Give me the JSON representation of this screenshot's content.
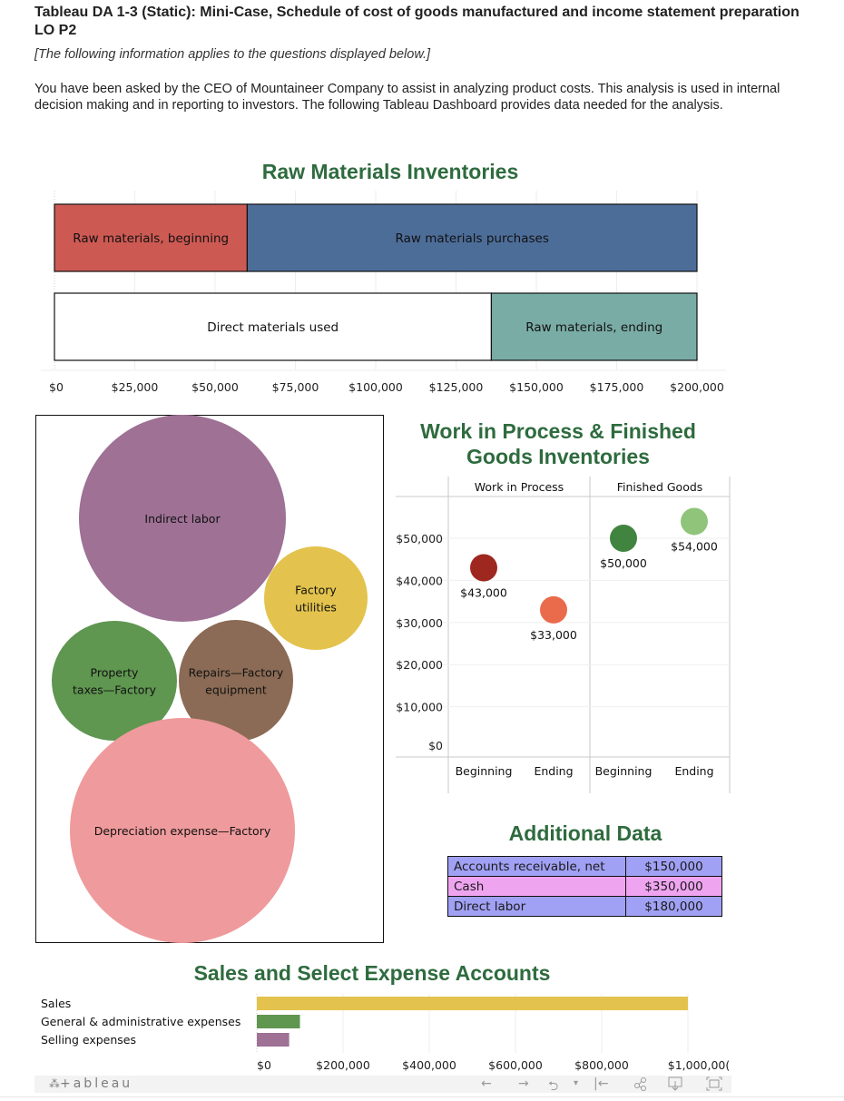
{
  "header": {
    "title": "Tableau DA 1-3 (Static): Mini-Case, Schedule of cost of goods manufactured and income statement preparation LO P2",
    "note": "[The following information applies to the questions displayed below.]",
    "intro": "You have been asked by the CEO of Mountaineer Company to assist in analyzing product costs. This analysis is used in internal decision making and in reporting to investors. The following Tableau Dashboard provides data needed for the analysis."
  },
  "colors": {
    "title_green": "#2e6b3e",
    "rm_beginning": "#cd5953",
    "rm_purchases": "#4d6d99",
    "dm_used": "#ffffff",
    "rm_ending": "#7aaca6",
    "indirect_labor": "#9e7195",
    "factory_utilities": "#e3c34d",
    "property_taxes": "#5f9650",
    "repairs": "#8b6b55",
    "depreciation": "#ef9a9c",
    "wip_beginning": "#9e2720",
    "wip_ending": "#ea6b4b",
    "fg_beginning": "#418440",
    "fg_ending": "#8fc47a",
    "sales": "#e3c34d",
    "ga": "#5f9650",
    "selling": "#9e7195",
    "row_blue": "#a0a0f4",
    "row_pink": "#efa4f0"
  },
  "chart_data": [
    {
      "id": "raw-materials",
      "type": "bar",
      "orientation": "horizontal-stacked",
      "title": "Raw Materials Inventories",
      "xlim": [
        0,
        200000
      ],
      "xticks": [
        "$0",
        "$25,000",
        "$50,000",
        "$75,000",
        "$100,000",
        "$125,000",
        "$150,000",
        "$175,000",
        "$200,000"
      ],
      "xtick_values": [
        0,
        25000,
        50000,
        75000,
        100000,
        125000,
        150000,
        175000,
        200000
      ],
      "grid": true,
      "rows": [
        {
          "segments": [
            {
              "name": "Raw materials, beginning",
              "value": 60000,
              "color_key": "rm_beginning"
            },
            {
              "name": "Raw materials purchases",
              "value": 140000,
              "color_key": "rm_purchases"
            }
          ]
        },
        {
          "segments": [
            {
              "name": "Direct materials used",
              "value": 136000,
              "color_key": "dm_used"
            },
            {
              "name": "Raw materials, ending",
              "value": 64000,
              "color_key": "rm_ending"
            }
          ]
        }
      ]
    },
    {
      "id": "factory-overhead",
      "type": "bubble",
      "title": "",
      "bubbles": [
        {
          "name": "Indirect labor",
          "label_lines": [
            "Indirect labor"
          ],
          "relative_size": 1.0,
          "color_key": "indirect_labor"
        },
        {
          "name": "Factory utilities",
          "label_lines": [
            "Factory",
            "utilities"
          ],
          "relative_size": 0.25,
          "color_key": "factory_utilities"
        },
        {
          "name": "Property taxes—Factory",
          "label_lines": [
            "Property",
            "taxes—Factory"
          ],
          "relative_size": 0.36,
          "color_key": "property_taxes"
        },
        {
          "name": "Repairs—Factory equipment",
          "label_lines": [
            "Repairs—Factory",
            "equipment"
          ],
          "relative_size": 0.32,
          "color_key": "repairs"
        },
        {
          "name": "Depreciation expense—Factory",
          "label_lines": [
            "Depreciation expense—Factory"
          ],
          "relative_size": 1.18,
          "color_key": "depreciation"
        }
      ]
    },
    {
      "id": "wip-fg",
      "type": "scatter",
      "title": "Work in Process & Finished Goods Inventories",
      "title_lines": [
        "Work in Process & Finished",
        "Goods Inventories"
      ],
      "ylim": [
        0,
        58000
      ],
      "yticks": [
        "$0",
        "$10,000",
        "$20,000",
        "$30,000",
        "$40,000",
        "$50,000"
      ],
      "ytick_values": [
        0,
        10000,
        20000,
        30000,
        40000,
        50000
      ],
      "grid": true,
      "panels": [
        {
          "name": "Work in Process",
          "points": [
            {
              "x": "Beginning",
              "value": 43000,
              "label": "$43,000",
              "color_key": "wip_beginning"
            },
            {
              "x": "Ending",
              "value": 33000,
              "label": "$33,000",
              "color_key": "wip_ending"
            }
          ]
        },
        {
          "name": "Finished Goods",
          "points": [
            {
              "x": "Beginning",
              "value": 50000,
              "label": "$50,000",
              "color_key": "fg_beginning"
            },
            {
              "x": "Ending",
              "value": 54000,
              "label": "$54,000",
              "color_key": "fg_ending"
            }
          ]
        }
      ]
    },
    {
      "id": "additional-data",
      "type": "table",
      "title": "Additional Data",
      "rows": [
        {
          "label": "Accounts receivable, net",
          "value": "$150,000",
          "color_key": "row_blue"
        },
        {
          "label": "Cash",
          "value": "$350,000",
          "color_key": "row_pink"
        },
        {
          "label": "Direct labor",
          "value": "$180,000",
          "color_key": "row_blue"
        }
      ]
    },
    {
      "id": "sales-expenses",
      "type": "bar",
      "orientation": "horizontal",
      "title": "Sales and Select Expense Accounts",
      "categories": [
        "Sales",
        "General & administrative expenses",
        "Selling expenses"
      ],
      "values": [
        1000000,
        100000,
        75000
      ],
      "color_keys": [
        "sales",
        "ga",
        "selling"
      ],
      "xlim": [
        0,
        1000000
      ],
      "xticks": [
        "$0",
        "$200,000",
        "$400,000",
        "$600,000",
        "$800,000",
        "$1,000,00("
      ],
      "xtick_values": [
        0,
        200000,
        400000,
        600000,
        800000,
        1000000
      ],
      "grid": true
    }
  ],
  "toolbar": {
    "logo": "+ableau",
    "undo_icon": "←",
    "redo_icon": "→",
    "revert_icon": "⮌",
    "dropdown_icon": "▾",
    "reset_icon": "|←",
    "share_icon": "share",
    "download_icon": "download",
    "fullscreen_icon": "fullscreen"
  }
}
